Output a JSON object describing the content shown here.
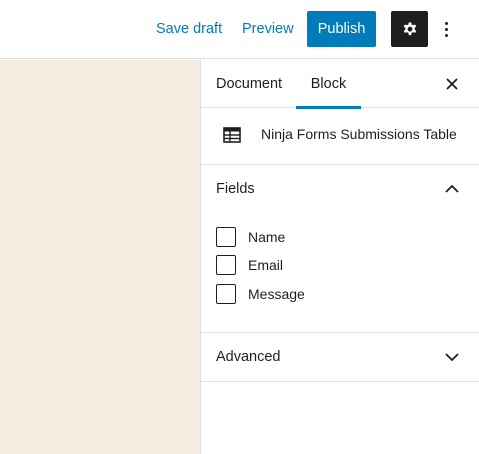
{
  "header": {
    "save_draft_label": "Save draft",
    "preview_label": "Preview",
    "publish_label": "Publish",
    "settings_icon": "gear-icon",
    "more_icon": "vertical-ellipsis-icon"
  },
  "sidebar": {
    "tabs": [
      {
        "label": "Document",
        "active": false
      },
      {
        "label": "Block",
        "active": true
      }
    ],
    "close_icon": "close-icon",
    "block": {
      "icon": "table-icon",
      "title": "Ninja Forms Submissions Table"
    },
    "fields_panel": {
      "title": "Fields",
      "expanded": true,
      "items": [
        {
          "label": "Name",
          "checked": false
        },
        {
          "label": "Email",
          "checked": false
        },
        {
          "label": "Message",
          "checked": false
        }
      ]
    },
    "advanced_panel": {
      "title": "Advanced",
      "expanded": false
    }
  },
  "colors": {
    "accent": "#007cba",
    "dark": "#1e1e1e",
    "canvas": "#f4ece0",
    "border": "#e0e0e0"
  }
}
